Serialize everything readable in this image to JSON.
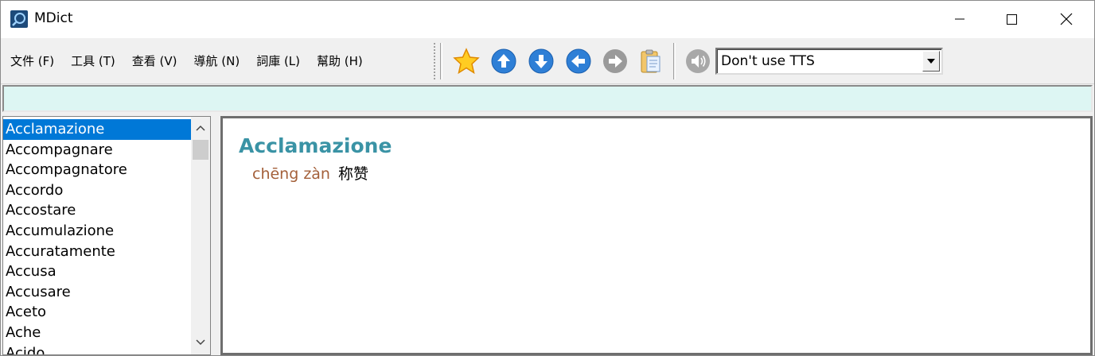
{
  "window": {
    "title": "MDict"
  },
  "menu": [
    {
      "label": "文件 (F)"
    },
    {
      "label": "工具 (T)"
    },
    {
      "label": "查看 (V)"
    },
    {
      "label": "導航 (N)"
    },
    {
      "label": "詞庫 (L)"
    },
    {
      "label": "幫助 (H)"
    }
  ],
  "toolbar": {
    "icons": [
      "star-icon",
      "arrow-up-icon",
      "arrow-down-icon",
      "arrow-left-icon",
      "arrow-right-icon",
      "clipboard-icon",
      "speaker-icon"
    ],
    "tts_select_value": "Don't use TTS"
  },
  "search": {
    "value": "",
    "placeholder": ""
  },
  "wordlist": {
    "selected_index": 0,
    "items": [
      "Acclamazione",
      "Accompagnare",
      "Accompagnatore",
      "Accordo",
      "Accostare",
      "Accumulazione",
      "Accuratamente",
      "Accusa",
      "Accusare",
      "Aceto",
      "Ache",
      "Acido"
    ]
  },
  "entry": {
    "headword": "Acclamazione",
    "pinyin": "chēng zàn",
    "meaning": "称赞"
  },
  "colors": {
    "headword": "#3a93a5",
    "pinyin": "#a4603a",
    "search_bg": "#ddf6f3",
    "selection": "#0078d7"
  }
}
